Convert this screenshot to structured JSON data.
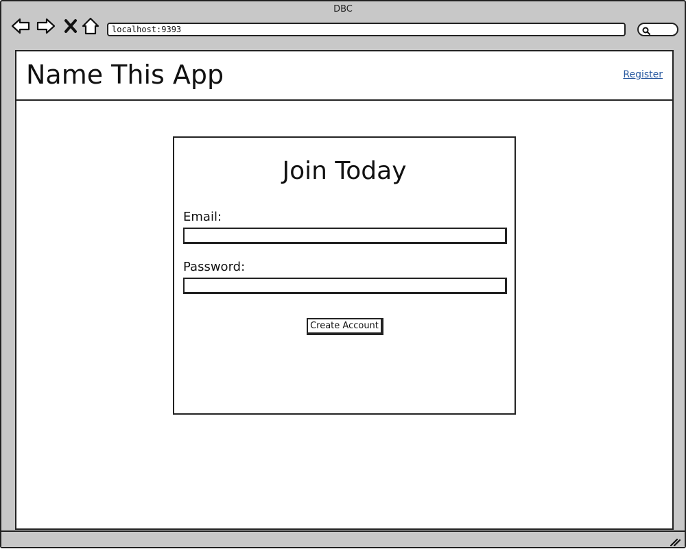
{
  "window": {
    "title": "DBC"
  },
  "browser": {
    "address": "localhost:9393",
    "icons": [
      "back-arrow-icon",
      "forward-arrow-icon",
      "close-x-icon",
      "home-icon",
      "search-icon"
    ]
  },
  "app": {
    "title": "Name This App",
    "register_link": "Register"
  },
  "signup": {
    "heading": "Join Today",
    "email_label": "Email:",
    "email_value": "",
    "password_label": "Password:",
    "password_value": "",
    "submit_label": "Create Account"
  }
}
